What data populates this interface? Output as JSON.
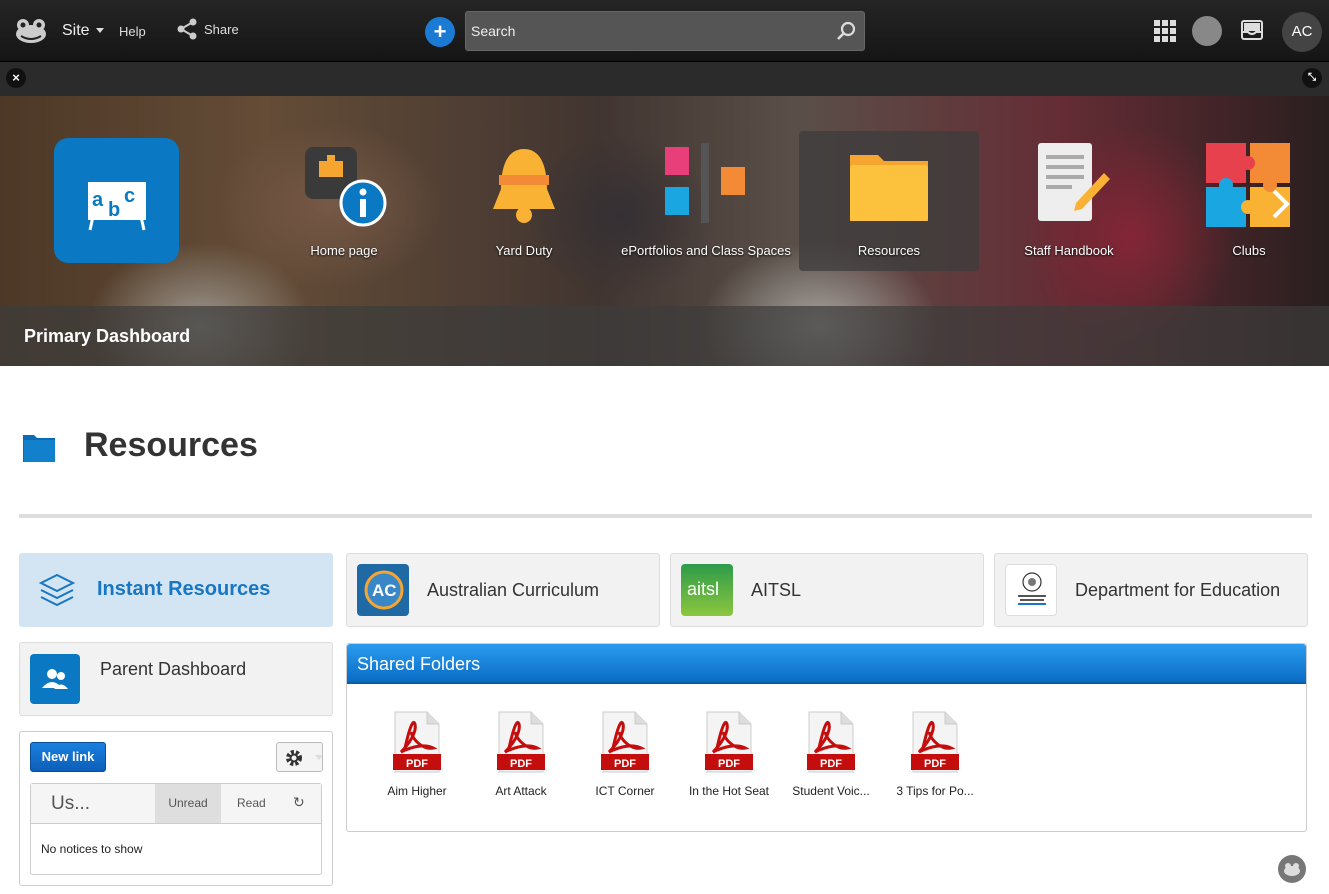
{
  "topbar": {
    "site_label": "Site",
    "help_label": "Help",
    "share_label": "Share",
    "search_placeholder": "Search",
    "avatar_initials": "AC"
  },
  "banner": {
    "apps": [
      {
        "label": "Home page"
      },
      {
        "label": "Yard Duty"
      },
      {
        "label": "ePortfolios and Class Spaces"
      },
      {
        "label": "Resources"
      },
      {
        "label": "Staff Handbook"
      },
      {
        "label": "Clubs"
      }
    ],
    "dashboard_title": "Primary Dashboard"
  },
  "page": {
    "title": "Resources"
  },
  "links": {
    "instant_resources": "Instant Resources",
    "australian_curriculum": "Australian Curriculum",
    "aitsl": "AITSL",
    "aitsl_logo_text": "aitsl",
    "ac_logo_text": "AC",
    "department": "Department for Education",
    "parent_dashboard": "Parent Dashboard"
  },
  "notices": {
    "new_link_label": "New link",
    "tab_us": "Us...",
    "tab_unread": "Unread",
    "tab_read": "Read",
    "empty_text": "No notices to show"
  },
  "shared_folders": {
    "title": "Shared Folders",
    "pdf_badge": "PDF",
    "files": [
      {
        "name": "Aim Higher"
      },
      {
        "name": "Art Attack"
      },
      {
        "name": "ICT Corner"
      },
      {
        "name": "In the Hot Seat"
      },
      {
        "name": "Student Voic..."
      },
      {
        "name": "3 Tips for Po..."
      }
    ]
  },
  "colors": {
    "accent": "#1976c2",
    "header_blue": "#0a6cc4",
    "tile_blue": "#0a78c2"
  }
}
